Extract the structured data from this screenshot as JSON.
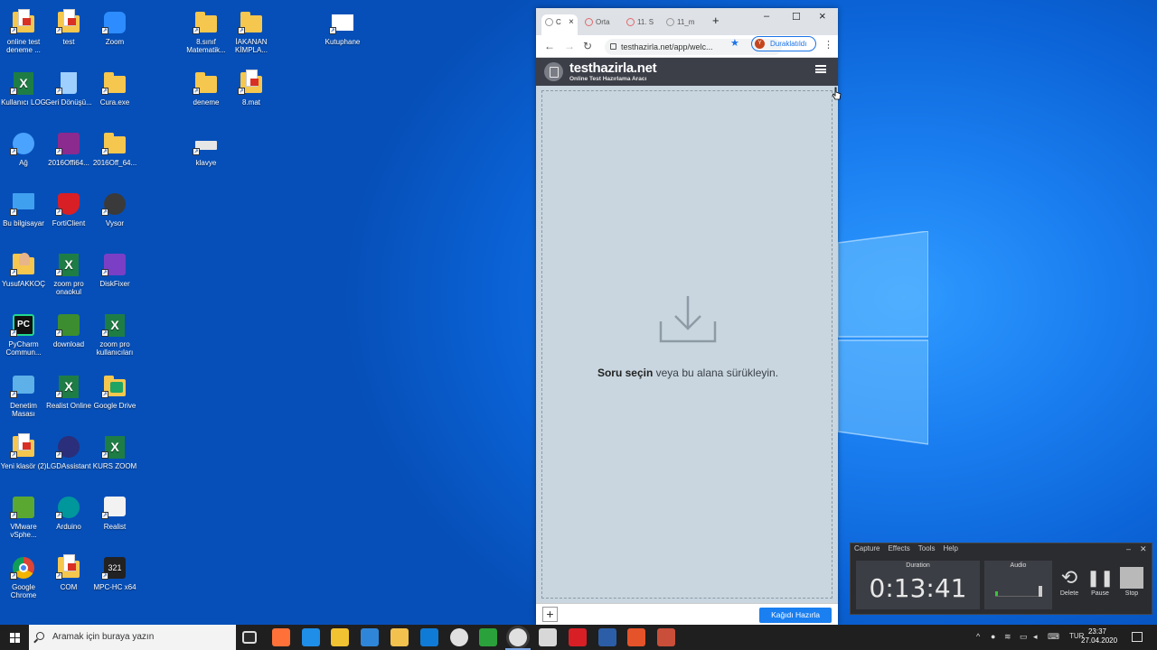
{
  "desktop": {
    "icons": [
      {
        "label": "online test deneme ...",
        "icon": "pdf-file-icon"
      },
      {
        "label": "test",
        "icon": "pdf-file-icon"
      },
      {
        "label": "Zoom",
        "icon": "zoom-camera-icon"
      },
      {
        "label": "8.sınıf Matematik...",
        "icon": "folder-icon"
      },
      {
        "label": "İAKANAN KİMPLA...",
        "icon": "folder-icon"
      },
      {
        "label": "Kutuphane",
        "icon": "library-app-icon"
      },
      {
        "label": "Kullanıcı LOG",
        "icon": "excel-icon"
      },
      {
        "label": "Geri Dönüşü...",
        "icon": "recycle-bin-icon"
      },
      {
        "label": "Cura.exe",
        "icon": "folder-icon"
      },
      {
        "label": "deneme",
        "icon": "folder-icon"
      },
      {
        "label": "8.mat",
        "icon": "pdf-file-icon"
      },
      {
        "label": "Ağ",
        "icon": "network-icon"
      },
      {
        "label": "2016Offi64...",
        "icon": "winrar-icon"
      },
      {
        "label": "2016Off_64...",
        "icon": "folder-icon"
      },
      {
        "label": "klavye",
        "icon": "keyboard-icon"
      },
      {
        "label": "Bu bilgisayar",
        "icon": "computer-icon"
      },
      {
        "label": "FortiClient",
        "icon": "forticlient-icon"
      },
      {
        "label": "Vysor",
        "icon": "vysor-icon"
      },
      {
        "label": "YusufAKKOÇ",
        "icon": "user-folder-icon"
      },
      {
        "label": "zoom pro onaokul",
        "icon": "excel-icon"
      },
      {
        "label": "DiskFixer",
        "icon": "diskfixer-icon"
      },
      {
        "label": "PyCharm Commun...",
        "icon": "pycharm-icon"
      },
      {
        "label": "download",
        "icon": "chip-icon"
      },
      {
        "label": "zoom pro kullanıcıları",
        "icon": "excel-icon"
      },
      {
        "label": "Denetim Masası",
        "icon": "control-panel-icon"
      },
      {
        "label": "Realist Online",
        "icon": "excel-icon"
      },
      {
        "label": "Google Drive",
        "icon": "google-drive-icon"
      },
      {
        "label": "Yeni klasör (2)",
        "icon": "pdf-file-icon"
      },
      {
        "label": "LGDAssistant",
        "icon": "lgd-assistant-icon"
      },
      {
        "label": "KURS ZOOM",
        "icon": "excel-icon"
      },
      {
        "label": "VMware vSphe...",
        "icon": "vmware-icon"
      },
      {
        "label": "Arduino",
        "icon": "arduino-icon"
      },
      {
        "label": "Realist",
        "icon": "realist-icon"
      },
      {
        "label": "Google Chrome",
        "icon": "chrome-icon"
      },
      {
        "label": "COM",
        "icon": "pdf-file-icon"
      },
      {
        "label": "MPC-HC x64",
        "icon": "mpc-player-icon"
      }
    ]
  },
  "browser": {
    "tabs": [
      {
        "label": "C",
        "active": true
      },
      {
        "label": "Orta",
        "active": false
      },
      {
        "label": "11. S",
        "active": false
      },
      {
        "label": "11_m",
        "active": false
      }
    ],
    "close_tab": "×",
    "new_tab": "+",
    "win_min": "–",
    "win_max": "☐",
    "win_close": "×",
    "nav_back": "←",
    "nav_fwd": "→",
    "nav_reload": "↻",
    "url": "testhazirla.net/app/welc...",
    "star": "★",
    "profile_initial": "Y",
    "profile_status": "Duraklatıldı",
    "menu": "⋮"
  },
  "site": {
    "brand": "testhazirla",
    "brand_tld": ".net",
    "tagline": "Online Test Hazırlama Aracı",
    "drop_bold": "Soru seçin",
    "drop_rest": " veya bu alana sürükleyin.",
    "add_label": "+",
    "prepare_button": "Kağıdı Hazırla"
  },
  "recorder": {
    "menu": [
      "Capture",
      "Effects",
      "Tools",
      "Help"
    ],
    "minimize": "–",
    "close": "✕",
    "duration_label": "Duration",
    "duration": "0:13:41",
    "audio_label": "Audio",
    "delete_label": "Delete",
    "pause_label": "Pause",
    "stop_label": "Stop",
    "delete_glyph": "⟲",
    "pause_glyph": "❚❚"
  },
  "taskbar": {
    "search_placeholder": "Aramak için buraya yazın",
    "apps": [
      "task-view",
      "firefox",
      "edge",
      "store",
      "mail",
      "file-explorer",
      "paint",
      "chrome",
      "camtasia",
      "chrome-active",
      "file-manager",
      "forticlient",
      "outlook",
      "camtasia-recorder",
      "snip-tool"
    ],
    "tray_arrow": "^",
    "tray_lang": "TUR",
    "time": "23:37",
    "date": "27.04.2020"
  },
  "colors": {
    "desktop_blue": "#0b63d6",
    "site_header": "#3c3f48",
    "workspace": "#c9d6df",
    "accent_button": "#1a7ff0"
  }
}
